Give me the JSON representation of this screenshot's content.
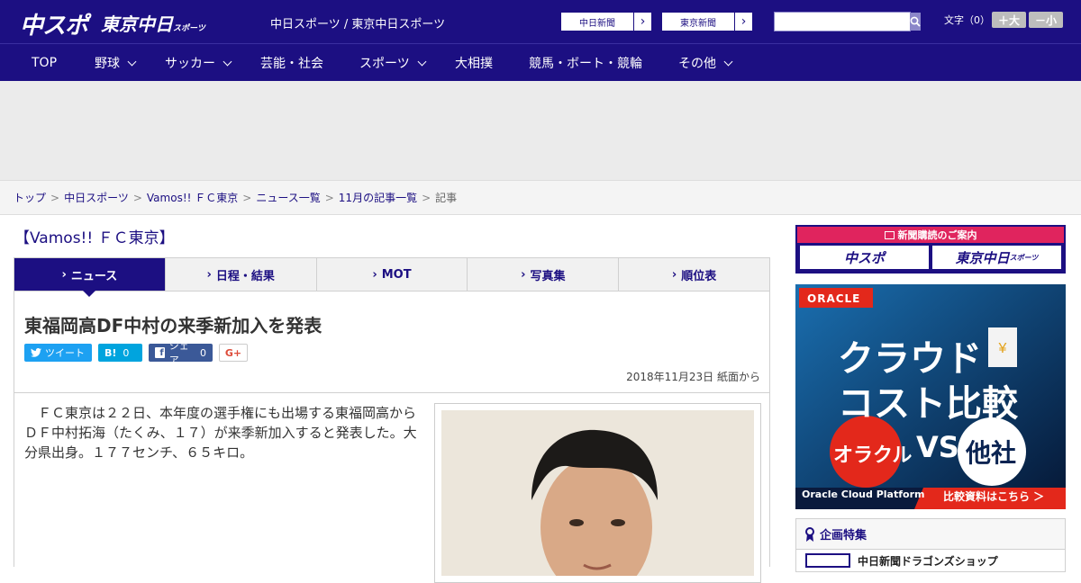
{
  "header": {
    "logo_main": "中スポ",
    "logo_tokyo": "東京中日",
    "logo_tokyo_small": "スポーツ",
    "site_name": "中日スポーツ / 東京中日スポーツ",
    "paper_links": [
      "中日新聞",
      "東京新聞"
    ],
    "search_placeholder": "",
    "font_size_label": "文字（0）",
    "font_up": "＋大",
    "font_down": "－小"
  },
  "nav": {
    "items": [
      {
        "label": "TOP",
        "dropdown": false
      },
      {
        "label": "野球",
        "dropdown": true
      },
      {
        "label": "サッカー",
        "dropdown": true
      },
      {
        "label": "芸能・社会",
        "dropdown": false
      },
      {
        "label": "スポーツ",
        "dropdown": true
      },
      {
        "label": "大相撲",
        "dropdown": false
      },
      {
        "label": "競馬・ボート・競輪",
        "dropdown": false
      },
      {
        "label": "その他",
        "dropdown": true
      }
    ]
  },
  "breadcrumb": {
    "links": [
      "トップ",
      "中日スポーツ",
      "Vamos!! ＦＣ東京",
      "ニュース一覧",
      "11月の記事一覧"
    ],
    "current": "記事",
    "separator": ">"
  },
  "section_title": "【Vamos!! ＦＣ東京】",
  "tabs": [
    {
      "label": "ニュース",
      "active": true
    },
    {
      "label": "日程・結果",
      "active": false
    },
    {
      "label": "MOT",
      "active": false
    },
    {
      "label": "写真集",
      "active": false
    },
    {
      "label": "順位表",
      "active": false
    }
  ],
  "article": {
    "headline": "東福岡高DF中村の来季新加入を発表",
    "share": {
      "tweet": "ツイート",
      "hatena": "B!",
      "hatena_count": "0",
      "facebook": "シェア",
      "facebook_count": "0",
      "gplus": "G+"
    },
    "date": "2018年11月23日 紙面から",
    "body": "ＦＣ東京は２２日、本年度の選手権にも出場する東福岡高からＤＦ中村拓海（たくみ、１７）が来季新加入すると発表した。大分県出身。１７７センチ、６５キロ。"
  },
  "sidebar": {
    "subscribe_head": "新聞購読のご案内",
    "subscribe_papers": [
      "中スポ",
      "東京中日"
    ],
    "subscribe_papers_small": "スポーツ",
    "ad": {
      "brand": "ORACLE",
      "line1": "クラウド",
      "line2": "コスト比較",
      "left_bubble": "オラクル",
      "vs": "VS",
      "right_bubble": "他社",
      "footer_left": "Oracle Cloud Platform",
      "footer_right": "比較資料はこちら ＞"
    },
    "feature_title": "企画特集",
    "feature_item": "中日新聞ドラゴンズショップ"
  },
  "colors": {
    "brand": "#1c0f82",
    "twitter": "#1da1f2",
    "hatena": "#00a4de",
    "facebook": "#3b5998",
    "subscribe_red": "#e0245e",
    "oracle_red": "#e3281b"
  }
}
